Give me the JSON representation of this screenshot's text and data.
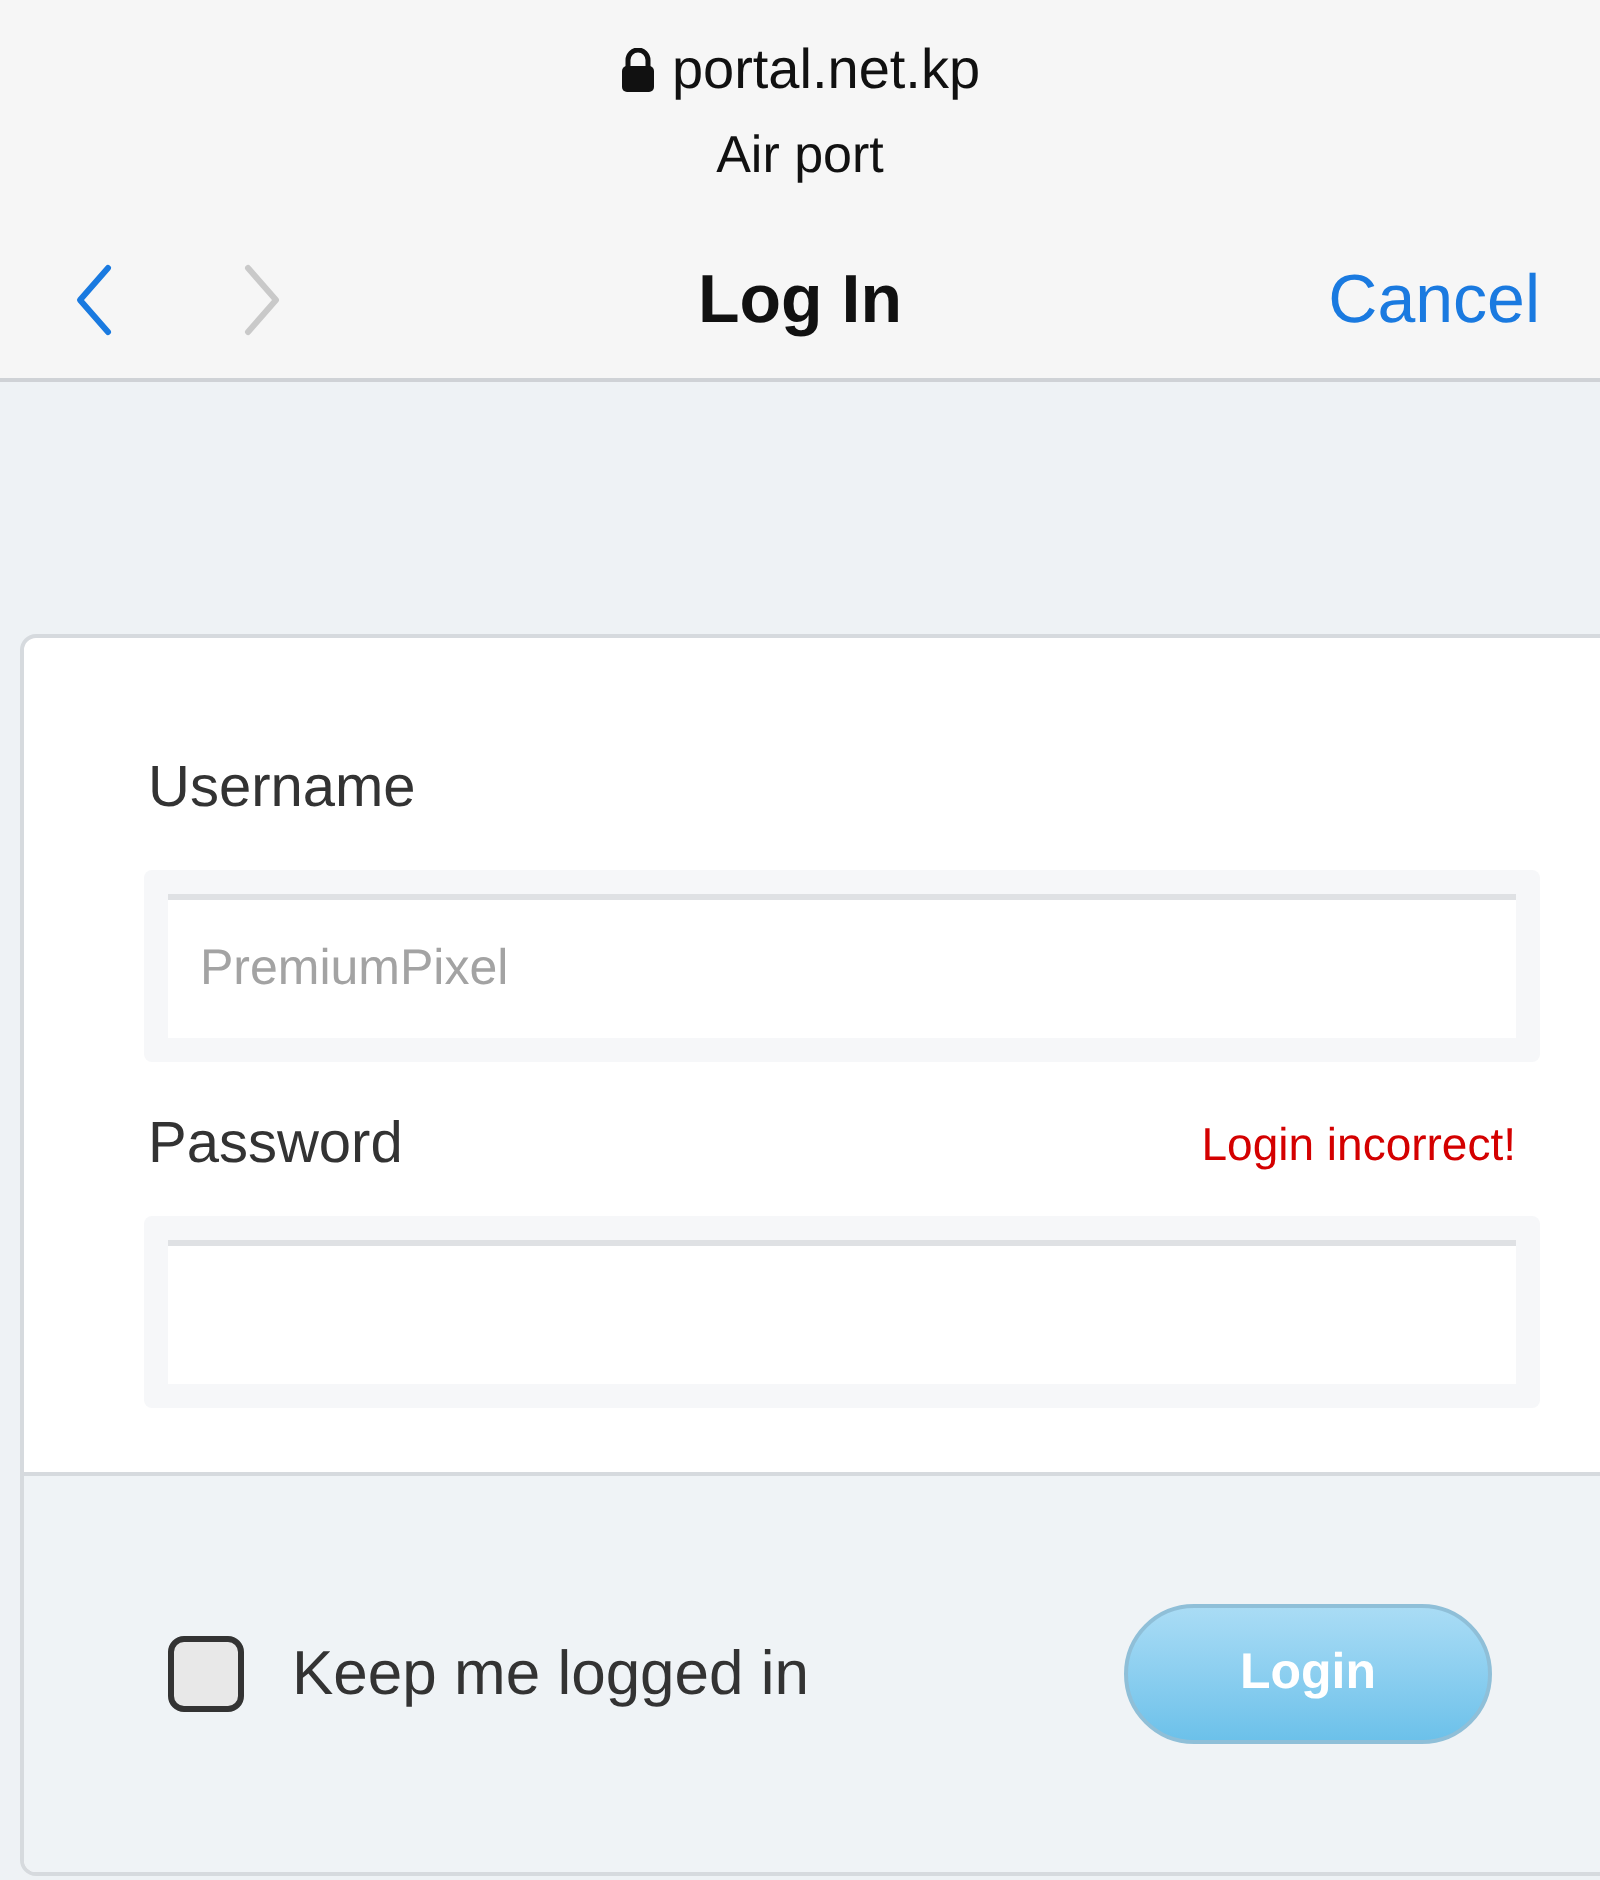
{
  "address_bar": {
    "url": "portal.net.kp",
    "network": "Air port"
  },
  "nav_bar": {
    "back": {
      "disabled": false
    },
    "forward": {
      "disabled": true
    },
    "title": "Log In",
    "cancel": "Cancel"
  },
  "form": {
    "username": {
      "label": "Username",
      "placeholder": "PremiumPixel"
    },
    "password": {
      "label": "Password",
      "error": "Login incorrect!"
    },
    "keep_logged_in": {
      "label": "Keep me logged in",
      "checked": false
    },
    "login_button": "Login"
  }
}
